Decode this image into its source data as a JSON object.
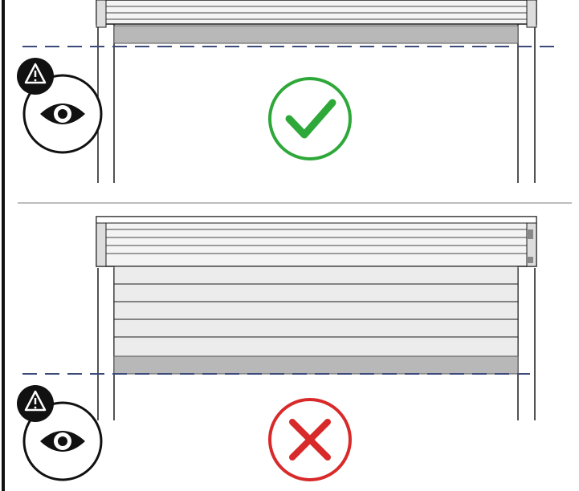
{
  "colors": {
    "correct": "#2fa83a",
    "incorrect": "#d82a2a",
    "guide_line": "#3b4a7a",
    "slat_fill": "#ececec",
    "bottom_bar": "#b8b8b8",
    "outline": "#1a1a1a"
  },
  "icons": {
    "warning": "warning-triangle-icon",
    "eye": "eye-icon",
    "correct": "checkmark-icon",
    "incorrect": "cross-icon"
  },
  "panels": [
    {
      "state": "correct",
      "shutter_lowered": false
    },
    {
      "state": "incorrect",
      "shutter_lowered": true
    }
  ]
}
